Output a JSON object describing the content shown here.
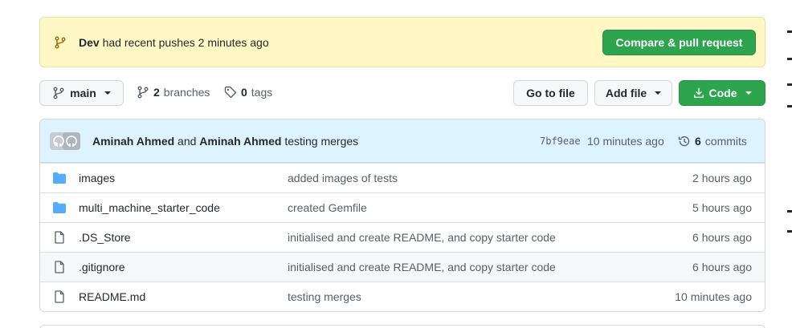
{
  "banner": {
    "branch": "Dev",
    "message": "had recent pushes 2 minutes ago",
    "button": "Compare & pull request"
  },
  "toolbar": {
    "branch_button": "main",
    "branches_count": "2",
    "branches_label": "branches",
    "tags_count": "0",
    "tags_label": "tags",
    "goto_file": "Go to file",
    "add_file": "Add file",
    "code": "Code"
  },
  "commit": {
    "author1": "Aminah Ahmed",
    "and": "and",
    "author2": "Aminah Ahmed",
    "message": "testing merges",
    "sha": "7bf9eae",
    "time": "10 minutes ago",
    "commits_count": "6",
    "commits_label": "commits"
  },
  "files": [
    {
      "type": "folder",
      "name": "images",
      "message": "added images of tests",
      "age": "2 hours ago"
    },
    {
      "type": "folder",
      "name": "multi_machine_starter_code",
      "message": "created Gemfile",
      "age": "5 hours ago"
    },
    {
      "type": "file",
      "name": ".DS_Store",
      "message": "initialised and create README, and copy starter code",
      "age": "6 hours ago"
    },
    {
      "type": "file",
      "name": ".gitignore",
      "message": "initialised and create README, and copy starter code",
      "age": "6 hours ago"
    },
    {
      "type": "file",
      "name": "README.md",
      "message": "testing merges",
      "age": "10 minutes ago"
    }
  ],
  "colors": {
    "banner_bg": "#fff8c5",
    "commit_bar_bg": "#ddf4ff",
    "green": "#2da44e",
    "folder": "#54aeff"
  }
}
